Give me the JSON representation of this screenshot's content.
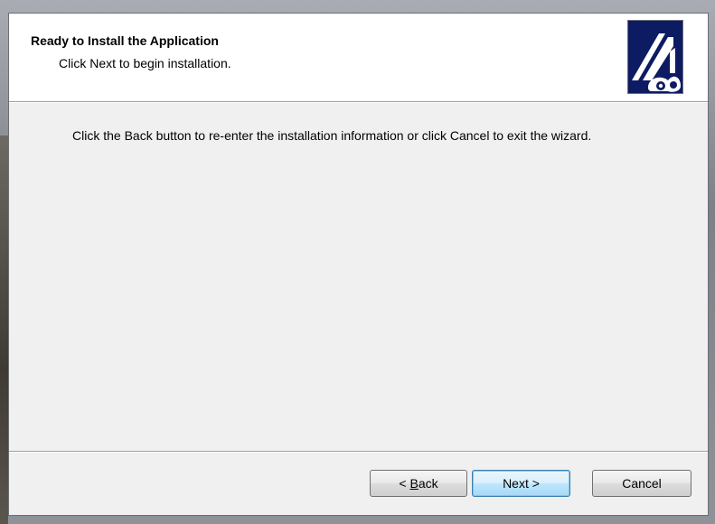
{
  "header": {
    "title": "Ready to Install the Application",
    "subtitle": "Click Next to begin installation."
  },
  "body": {
    "message": "Click the Back button to re-enter the installation information or click Cancel to exit the wizard."
  },
  "buttons": {
    "back_prefix": "< ",
    "back_mnemonic": "B",
    "back_rest": "ack",
    "next_label": "Next >",
    "cancel_label": "Cancel"
  },
  "icons": {
    "logo": "installer-logo-icon"
  },
  "colors": {
    "logo_background": "#0d1b63",
    "default_button_border": "#3c7fb1"
  }
}
